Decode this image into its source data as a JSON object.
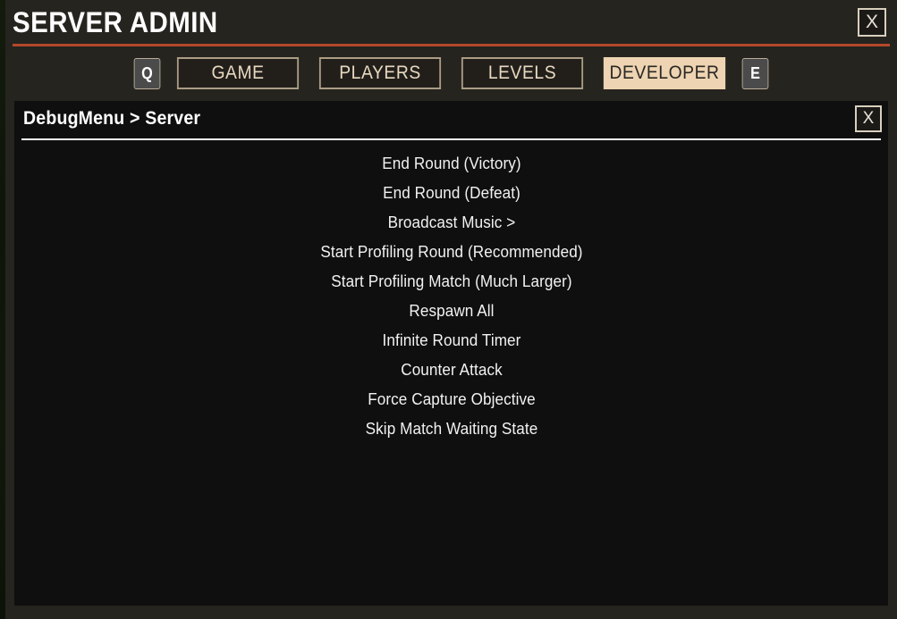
{
  "admin": {
    "title": "SERVER ADMIN",
    "close_label": "X",
    "accent_color": "#b4492a",
    "panel_color": "#26241f"
  },
  "tabs": {
    "prev_key": "Q",
    "next_key": "E",
    "items": [
      {
        "label": "GAME",
        "active": false
      },
      {
        "label": "PLAYERS",
        "active": false
      },
      {
        "label": "LEVELS",
        "active": false
      },
      {
        "label": "DEVELOPER",
        "active": true
      }
    ],
    "active_bg": "#eed4b2",
    "border_color": "#ab9d85"
  },
  "debug_menu": {
    "breadcrumb": "DebugMenu > Server",
    "close_label": "X",
    "background": "#0f0f0f",
    "items": [
      {
        "label": "End Round (Victory)",
        "submenu": false
      },
      {
        "label": "End Round (Defeat)",
        "submenu": false
      },
      {
        "label": "Broadcast Music >",
        "submenu": true
      },
      {
        "label": "Start Profiling Round (Recommended)",
        "submenu": false
      },
      {
        "label": "Start Profiling Match (Much Larger)",
        "submenu": false
      },
      {
        "label": "Respawn All",
        "submenu": false
      },
      {
        "label": "Infinite Round Timer",
        "submenu": false
      },
      {
        "label": "Counter Attack",
        "submenu": false
      },
      {
        "label": "Force Capture Objective",
        "submenu": false
      },
      {
        "label": "Skip Match Waiting State",
        "submenu": false
      }
    ]
  }
}
